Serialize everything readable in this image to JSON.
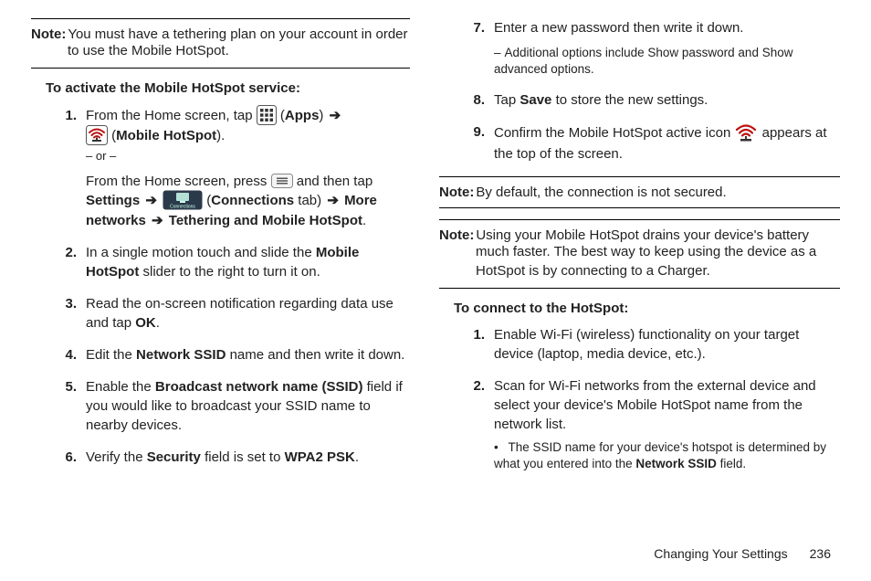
{
  "left": {
    "note1_label": "Note:",
    "note1_line1": "You must have a tethering plan on your account in order",
    "note1_line2": "to use the Mobile HotSpot.",
    "heading": "To activate the Mobile HotSpot service:",
    "step1": {
      "num": "1.",
      "a": "From the Home screen, tap ",
      "b": " (",
      "apps": "Apps",
      "c": ") ",
      "d": " (",
      "mh": "Mobile HotSpot",
      "e": ").",
      "or": "– or –",
      "alt_l1a": "From the Home screen, press ",
      "alt_l1b": " and then tap ",
      "alt_l2a": "Settings",
      "alt_l2b": " ",
      "alt_l2c": " (",
      "alt_l2d": "Connections",
      "alt_l2e": " tab) ",
      "alt_l2f": "More",
      "alt_l3a": "networks",
      "alt_l3b": " ",
      "alt_l3c": "Tethering and Mobile HotSpot",
      "alt_l3d": "."
    },
    "step2": {
      "num": "2.",
      "a": "In a single motion touch and slide the ",
      "b": "Mobile HotSpot",
      "c": " slider to the right to turn it on."
    },
    "step3": {
      "num": "3.",
      "a": "Read the on-screen notification regarding data use and tap ",
      "b": "OK",
      "c": "."
    },
    "step4": {
      "num": "4.",
      "a": "Edit the ",
      "b": "Network SSID",
      "c": " name and then write it down."
    },
    "step5": {
      "num": "5.",
      "a": "Enable the ",
      "b": "Broadcast network name (SSID)",
      "c": " field if you would like to broadcast your SSID name to nearby devices."
    },
    "step6": {
      "num": "6.",
      "a": "Verify the ",
      "b": "Security",
      "c": " field is set to ",
      "d": "WPA2 PSK",
      "e": "."
    }
  },
  "right": {
    "step7": {
      "num": "7.",
      "a": "Enter a new password then write it down.",
      "sub": "Additional options include Show password and Show advanced options."
    },
    "step8": {
      "num": "8.",
      "a": "Tap ",
      "b": "Save",
      "c": " to store the new settings."
    },
    "step9": {
      "num": "9.",
      "a": "Confirm the Mobile HotSpot active icon ",
      "b": " appears at the top of the screen."
    },
    "note2_label": "Note:",
    "note2_text": "By default, the connection is not secured.",
    "note3_label": "Note:",
    "note3_l1": "Using your Mobile HotSpot drains your device's battery",
    "note3_l2": "much faster. The best way to keep using the device as a",
    "note3_l3": "HotSpot is by connecting to a Charger.",
    "heading": "To connect to the HotSpot:",
    "cstep1": {
      "num": "1.",
      "a": "Enable Wi-Fi (wireless) functionality on your target device (laptop, media device, etc.)."
    },
    "cstep2": {
      "num": "2.",
      "a": "Scan for Wi-Fi networks from the external device and select your device's Mobile HotSpot name from the network list.",
      "sub_a": "The SSID name for your device's hotspot is determined by what you entered into the ",
      "sub_b": "Network SSID",
      "sub_c": " field."
    }
  },
  "footer": {
    "section": "Changing Your Settings",
    "page": "236"
  },
  "arrow": "➔",
  "dash": "–"
}
